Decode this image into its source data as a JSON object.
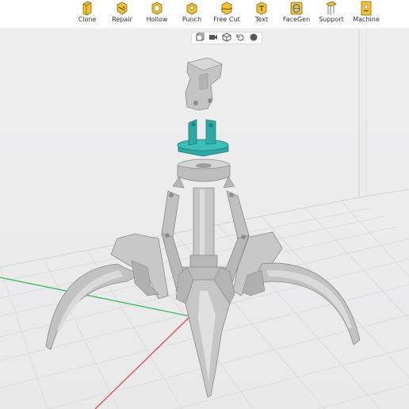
{
  "toolbar": {
    "items": [
      {
        "label": "Clone",
        "icon": "clone-icon"
      },
      {
        "label": "Repair",
        "icon": "repair-icon"
      },
      {
        "label": "Hollow",
        "icon": "hollow-icon"
      },
      {
        "label": "Punch",
        "icon": "punch-icon"
      },
      {
        "label": "Free Cut",
        "icon": "free-cut-icon"
      },
      {
        "label": "Text",
        "icon": "text-icon"
      },
      {
        "label": "FaceGen",
        "icon": "facegen-icon"
      },
      {
        "label": "Support",
        "icon": "support-icon"
      },
      {
        "label": "Machine",
        "icon": "machine-icon"
      }
    ],
    "icon_color": "#f2c230"
  },
  "view_controls": {
    "items": [
      "solid-view-icon",
      "camera-view-icon",
      "cube-view-icon",
      "reset-view-icon",
      "sphere-view-icon"
    ]
  },
  "scene": {
    "model": "claw-grabber-model",
    "model_color": "#c2c2c2",
    "highlight_part_color": "#2fa9a3",
    "x_axis_color": "#e05050",
    "y_axis_color": "#3cc060",
    "grid_color": "#d9d9da"
  }
}
